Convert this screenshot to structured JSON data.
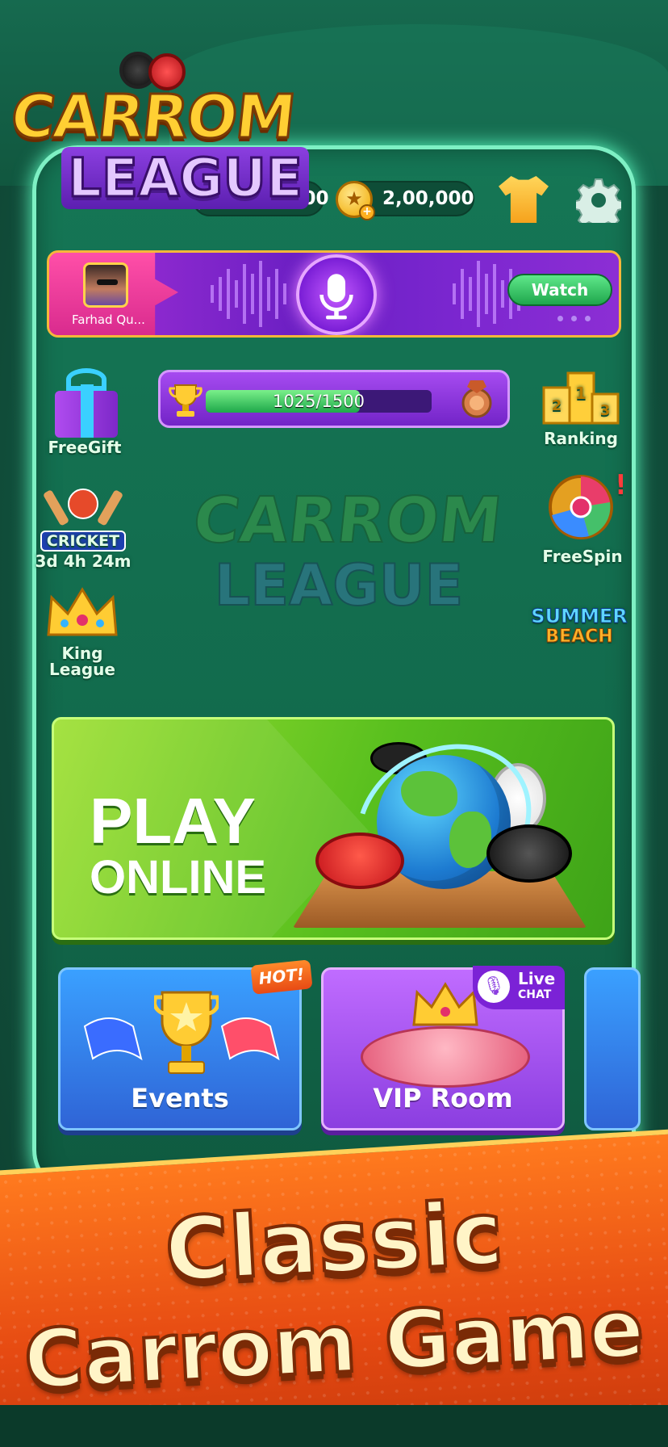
{
  "logo": {
    "line1": "CARROM",
    "line2": "LEAGUE"
  },
  "header": {
    "gems_value": "2,00,000",
    "coins_value": "2,00,000",
    "outfit_icon": "shirt-icon",
    "settings_icon": "gear-icon"
  },
  "banner": {
    "user_name": "Farhad Qu...",
    "watch_label": "Watch",
    "page_dots": 3
  },
  "side_left": [
    {
      "label": "FreeGift",
      "icon": "gift-icon"
    },
    {
      "label": "CRICKET",
      "sub": "3d 4h 24m",
      "icon": "cricket-icon"
    },
    {
      "label": "King League",
      "icon": "crown-icon"
    }
  ],
  "side_right": [
    {
      "label": "Ranking",
      "icon": "podium-icon"
    },
    {
      "label": "FreeSpin",
      "icon": "wheel-icon"
    },
    {
      "label_1": "SUMMER",
      "label_2": "BEACH",
      "icon": "summer-beach-icon"
    }
  ],
  "progress": {
    "text": "1025/1500",
    "value": 1025,
    "max": 1500
  },
  "watermark": {
    "line1": "CARROM",
    "line2": "LEAGUE"
  },
  "play": {
    "line1": "PLAY",
    "line2": "ONLINE"
  },
  "cards": [
    {
      "label": "Events",
      "badge": "HOT!"
    },
    {
      "label": "VIP Room",
      "badge_1": "Live",
      "badge_2": "CHAT"
    }
  ],
  "promo": {
    "line1": "Classic",
    "line2": "Carrom Game"
  },
  "colors": {
    "accent_green": "#58bf1e",
    "purple": "#8b3ee0",
    "orange": "#e64a12",
    "gold": "#ffcf33"
  }
}
